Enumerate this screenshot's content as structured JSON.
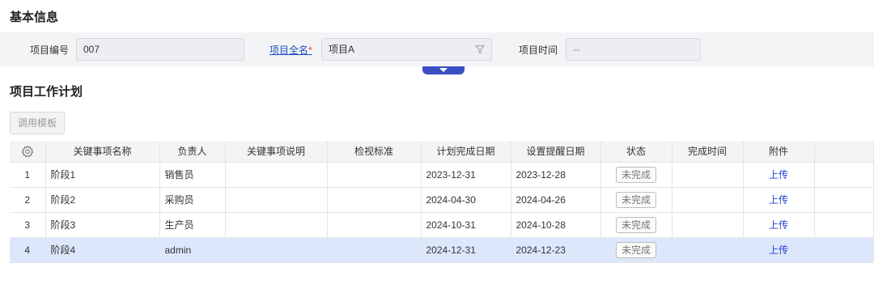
{
  "basic_info": {
    "title": "基本信息",
    "project_code_label": "项目编号",
    "project_code_value": "007",
    "project_name_label": "项目全名",
    "project_name_required": "*",
    "project_name_value": "项目A",
    "project_time_label": "项目时间",
    "project_time_value": "--"
  },
  "plan": {
    "title": "项目工作计划",
    "template_button": "调用模板",
    "columns": [
      "关键事项名称",
      "负责人",
      "关键事项说明",
      "检视标准",
      "计划完成日期",
      "设置提醒日期",
      "状态",
      "完成时间",
      "附件"
    ],
    "rows": [
      {
        "index": "1",
        "name": "阶段1",
        "owner": "销售员",
        "desc": "",
        "standard": "",
        "plan_date": "2023-12-31",
        "remind_date": "2023-12-28",
        "status": "未完成",
        "done_time": "",
        "attachment": "上传",
        "selected": false
      },
      {
        "index": "2",
        "name": "阶段2",
        "owner": "采购员",
        "desc": "",
        "standard": "",
        "plan_date": "2024-04-30",
        "remind_date": "2024-04-26",
        "status": "未完成",
        "done_time": "",
        "attachment": "上传",
        "selected": false
      },
      {
        "index": "3",
        "name": "阶段3",
        "owner": "生产员",
        "desc": "",
        "standard": "",
        "plan_date": "2024-10-31",
        "remind_date": "2024-10-28",
        "status": "未完成",
        "done_time": "",
        "attachment": "上传",
        "selected": false
      },
      {
        "index": "4",
        "name": "阶段4",
        "owner": "admin",
        "desc": "",
        "standard": "",
        "plan_date": "2024-12-31",
        "remind_date": "2024-12-23",
        "status": "未完成",
        "done_time": "",
        "attachment": "上传",
        "selected": true
      }
    ]
  },
  "colors": {
    "accent": "#3b4fc4",
    "link": "#1f3fd0",
    "selected_row": "#dde7fb",
    "required": "#e53935"
  },
  "icons": {
    "settings": "gear-icon",
    "filter": "filter-icon",
    "collapse": "chevron-down-icon"
  }
}
